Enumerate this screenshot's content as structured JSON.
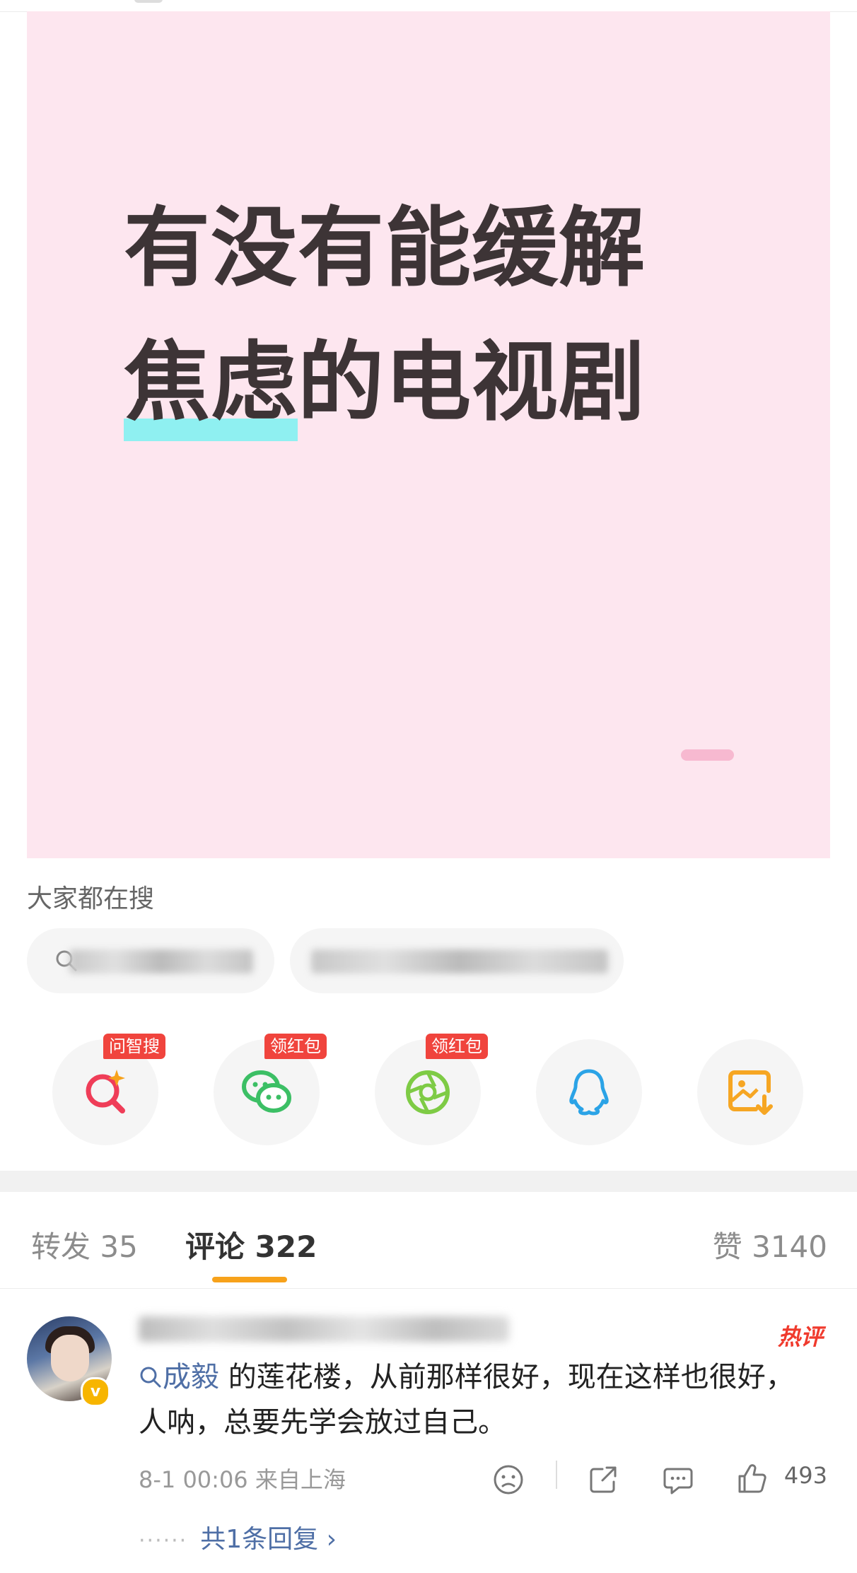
{
  "post": {
    "image_line1": "有没有能缓解",
    "image_line2_highlight": "焦虑",
    "image_line2_rest": "的电视剧"
  },
  "search": {
    "title": "大家都在搜"
  },
  "share": {
    "items": [
      {
        "icon": "ai-search-icon",
        "badge": "问智搜"
      },
      {
        "icon": "wechat-icon",
        "badge": "领红包"
      },
      {
        "icon": "moments-icon",
        "badge": "领红包"
      },
      {
        "icon": "qq-icon",
        "badge": ""
      },
      {
        "icon": "save-image-icon",
        "badge": ""
      }
    ]
  },
  "tabs": {
    "repost": "转发 35",
    "comments": "评论 322",
    "likes": "赞 3140"
  },
  "comment": {
    "hot_label": "热评",
    "mention": "成毅",
    "text_after_mention": " 的莲花楼，从前那样很好，现在这样也很好，人呐，总要先学会放过自己。",
    "time": "8-1 00:06",
    "location": "来自上海",
    "like_count": "493",
    "dots": "······",
    "replies": "共1条回复",
    "replies_chevron": "›"
  },
  "colors": {
    "image_bg": "#fde6ef",
    "highlight": "#8ff0f1",
    "accent": "#f7a21b",
    "badge_red": "#f0443d",
    "link_blue": "#4f6fa6"
  }
}
